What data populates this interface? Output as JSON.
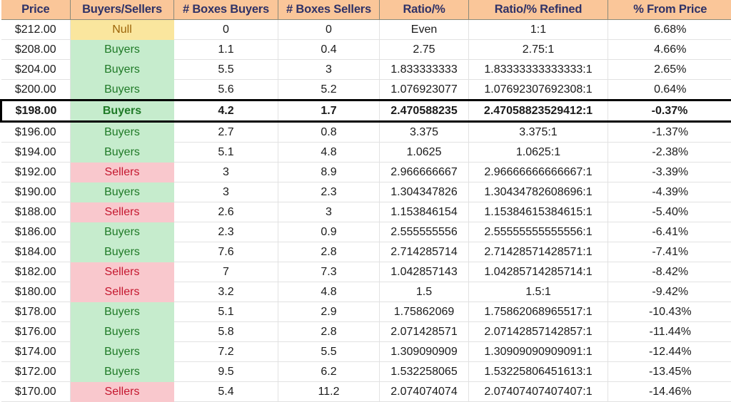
{
  "table": {
    "columns": [
      "Price",
      "Buyers/Sellers",
      "# Boxes Buyers",
      "# Boxes Sellers",
      "Ratio/%",
      "Ratio/% Refined",
      "% From Price"
    ],
    "highlight_row_index": 4,
    "colors": {
      "header_bg": "#fac699",
      "header_text": "#2f3267",
      "buyers_bg": "#c6eccd",
      "buyers_text": "#1f7a27",
      "sellers_bg": "#f9c8cd",
      "sellers_text": "#c4172e",
      "null_bg": "#fae69e",
      "null_text": "#9c6408",
      "highlight_border": "#000000"
    },
    "rows": [
      {
        "price": "$212.00",
        "side": "Null",
        "side_kind": "null",
        "boxes_buyers": "0",
        "boxes_sellers": "0",
        "ratio": "Even",
        "ratio_refined": "1:1",
        "pct_from_price": "6.68%"
      },
      {
        "price": "$208.00",
        "side": "Buyers",
        "side_kind": "buyers",
        "boxes_buyers": "1.1",
        "boxes_sellers": "0.4",
        "ratio": "2.75",
        "ratio_refined": "2.75:1",
        "pct_from_price": "4.66%"
      },
      {
        "price": "$204.00",
        "side": "Buyers",
        "side_kind": "buyers",
        "boxes_buyers": "5.5",
        "boxes_sellers": "3",
        "ratio": "1.833333333",
        "ratio_refined": "1.83333333333333:1",
        "pct_from_price": "2.65%"
      },
      {
        "price": "$200.00",
        "side": "Buyers",
        "side_kind": "buyers",
        "boxes_buyers": "5.6",
        "boxes_sellers": "5.2",
        "ratio": "1.076923077",
        "ratio_refined": "1.07692307692308:1",
        "pct_from_price": "0.64%"
      },
      {
        "price": "$198.00",
        "side": "Buyers",
        "side_kind": "buyers",
        "boxes_buyers": "4.2",
        "boxes_sellers": "1.7",
        "ratio": "2.470588235",
        "ratio_refined": "2.47058823529412:1",
        "pct_from_price": "-0.37%"
      },
      {
        "price": "$196.00",
        "side": "Buyers",
        "side_kind": "buyers",
        "boxes_buyers": "2.7",
        "boxes_sellers": "0.8",
        "ratio": "3.375",
        "ratio_refined": "3.375:1",
        "pct_from_price": "-1.37%"
      },
      {
        "price": "$194.00",
        "side": "Buyers",
        "side_kind": "buyers",
        "boxes_buyers": "5.1",
        "boxes_sellers": "4.8",
        "ratio": "1.0625",
        "ratio_refined": "1.0625:1",
        "pct_from_price": "-2.38%"
      },
      {
        "price": "$192.00",
        "side": "Sellers",
        "side_kind": "sellers",
        "boxes_buyers": "3",
        "boxes_sellers": "8.9",
        "ratio": "2.966666667",
        "ratio_refined": "2.96666666666667:1",
        "pct_from_price": "-3.39%"
      },
      {
        "price": "$190.00",
        "side": "Buyers",
        "side_kind": "buyers",
        "boxes_buyers": "3",
        "boxes_sellers": "2.3",
        "ratio": "1.304347826",
        "ratio_refined": "1.30434782608696:1",
        "pct_from_price": "-4.39%"
      },
      {
        "price": "$188.00",
        "side": "Sellers",
        "side_kind": "sellers",
        "boxes_buyers": "2.6",
        "boxes_sellers": "3",
        "ratio": "1.153846154",
        "ratio_refined": "1.15384615384615:1",
        "pct_from_price": "-5.40%"
      },
      {
        "price": "$186.00",
        "side": "Buyers",
        "side_kind": "buyers",
        "boxes_buyers": "2.3",
        "boxes_sellers": "0.9",
        "ratio": "2.555555556",
        "ratio_refined": "2.55555555555556:1",
        "pct_from_price": "-6.41%"
      },
      {
        "price": "$184.00",
        "side": "Buyers",
        "side_kind": "buyers",
        "boxes_buyers": "7.6",
        "boxes_sellers": "2.8",
        "ratio": "2.714285714",
        "ratio_refined": "2.71428571428571:1",
        "pct_from_price": "-7.41%"
      },
      {
        "price": "$182.00",
        "side": "Sellers",
        "side_kind": "sellers",
        "boxes_buyers": "7",
        "boxes_sellers": "7.3",
        "ratio": "1.042857143",
        "ratio_refined": "1.04285714285714:1",
        "pct_from_price": "-8.42%"
      },
      {
        "price": "$180.00",
        "side": "Sellers",
        "side_kind": "sellers",
        "boxes_buyers": "3.2",
        "boxes_sellers": "4.8",
        "ratio": "1.5",
        "ratio_refined": "1.5:1",
        "pct_from_price": "-9.42%"
      },
      {
        "price": "$178.00",
        "side": "Buyers",
        "side_kind": "buyers",
        "boxes_buyers": "5.1",
        "boxes_sellers": "2.9",
        "ratio": "1.75862069",
        "ratio_refined": "1.75862068965517:1",
        "pct_from_price": "-10.43%"
      },
      {
        "price": "$176.00",
        "side": "Buyers",
        "side_kind": "buyers",
        "boxes_buyers": "5.8",
        "boxes_sellers": "2.8",
        "ratio": "2.071428571",
        "ratio_refined": "2.07142857142857:1",
        "pct_from_price": "-11.44%"
      },
      {
        "price": "$174.00",
        "side": "Buyers",
        "side_kind": "buyers",
        "boxes_buyers": "7.2",
        "boxes_sellers": "5.5",
        "ratio": "1.309090909",
        "ratio_refined": "1.30909090909091:1",
        "pct_from_price": "-12.44%"
      },
      {
        "price": "$172.00",
        "side": "Buyers",
        "side_kind": "buyers",
        "boxes_buyers": "9.5",
        "boxes_sellers": "6.2",
        "ratio": "1.532258065",
        "ratio_refined": "1.53225806451613:1",
        "pct_from_price": "-13.45%"
      },
      {
        "price": "$170.00",
        "side": "Sellers",
        "side_kind": "sellers",
        "boxes_buyers": "5.4",
        "boxes_sellers": "11.2",
        "ratio": "2.074074074",
        "ratio_refined": "2.07407407407407:1",
        "pct_from_price": "-14.46%"
      }
    ]
  }
}
